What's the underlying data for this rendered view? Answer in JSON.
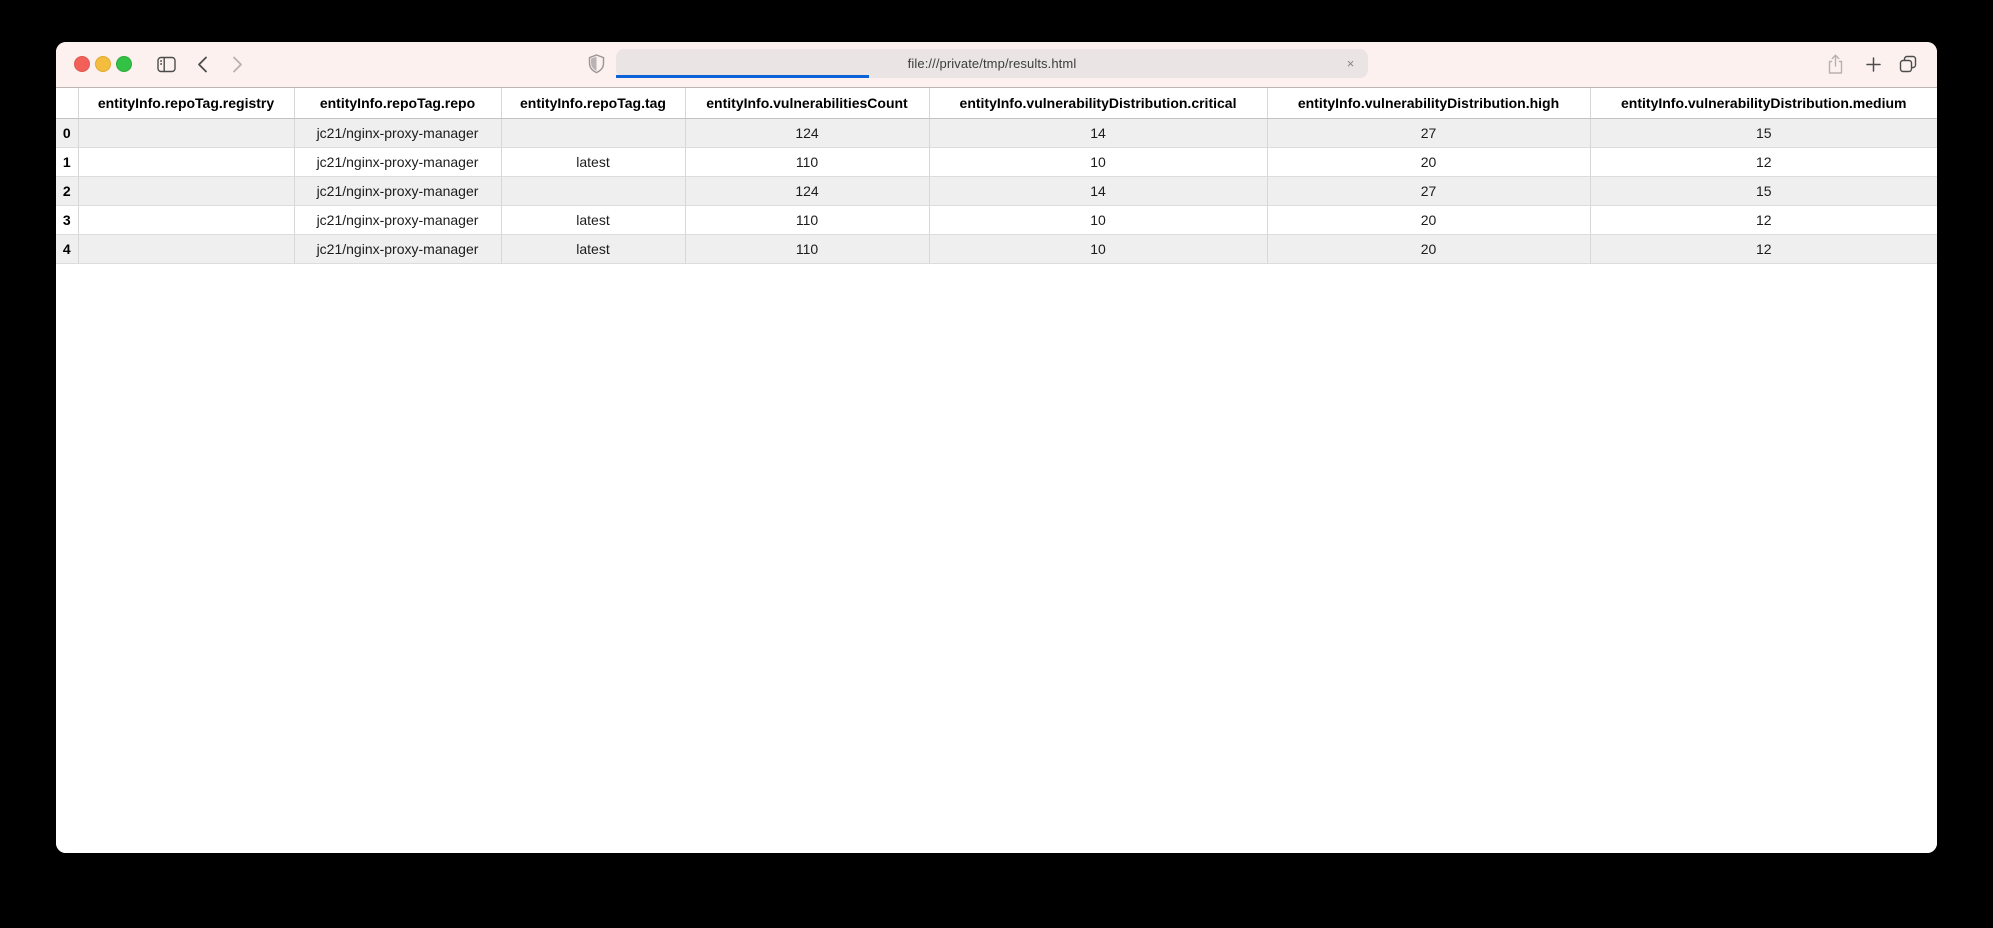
{
  "browser": {
    "traffic_lights": [
      "close",
      "minimize",
      "zoom"
    ],
    "toolbar_icons": [
      "sidebar-icon",
      "back-icon",
      "forward-icon",
      "privacy-shield-icon",
      "share-icon",
      "new-tab-icon",
      "tab-overview-icon"
    ],
    "url": "file:///private/tmp/results.html",
    "clear_label": "×",
    "progress_fraction": "0.34",
    "colors": {
      "toolbar_bg": "#fcf1ef",
      "field_bg": "#eae4e4",
      "progress_blue": "#0c63d8",
      "traffic_red": "#f2605a",
      "traffic_yellow": "#f5bd3e",
      "traffic_green": "#33c146"
    }
  },
  "table": {
    "columns": [
      "",
      "entityInfo.repoTag.registry",
      "entityInfo.repoTag.repo",
      "entityInfo.repoTag.tag",
      "entityInfo.vulnerabilitiesCount",
      "entityInfo.vulnerabilityDistribution.critical",
      "entityInfo.vulnerabilityDistribution.high",
      "entityInfo.vulnerabilityDistribution.medium"
    ],
    "rows": [
      [
        "0",
        "",
        "jc21/nginx-proxy-manager",
        "",
        "124",
        "14",
        "27",
        "15"
      ],
      [
        "1",
        "",
        "jc21/nginx-proxy-manager",
        "latest",
        "110",
        "10",
        "20",
        "12"
      ],
      [
        "2",
        "",
        "jc21/nginx-proxy-manager",
        "",
        "124",
        "14",
        "27",
        "15"
      ],
      [
        "3",
        "",
        "jc21/nginx-proxy-manager",
        "latest",
        "110",
        "10",
        "20",
        "12"
      ],
      [
        "4",
        "",
        "jc21/nginx-proxy-manager",
        "latest",
        "110",
        "10",
        "20",
        "12"
      ]
    ],
    "row_stripe_color": "#efefef"
  }
}
